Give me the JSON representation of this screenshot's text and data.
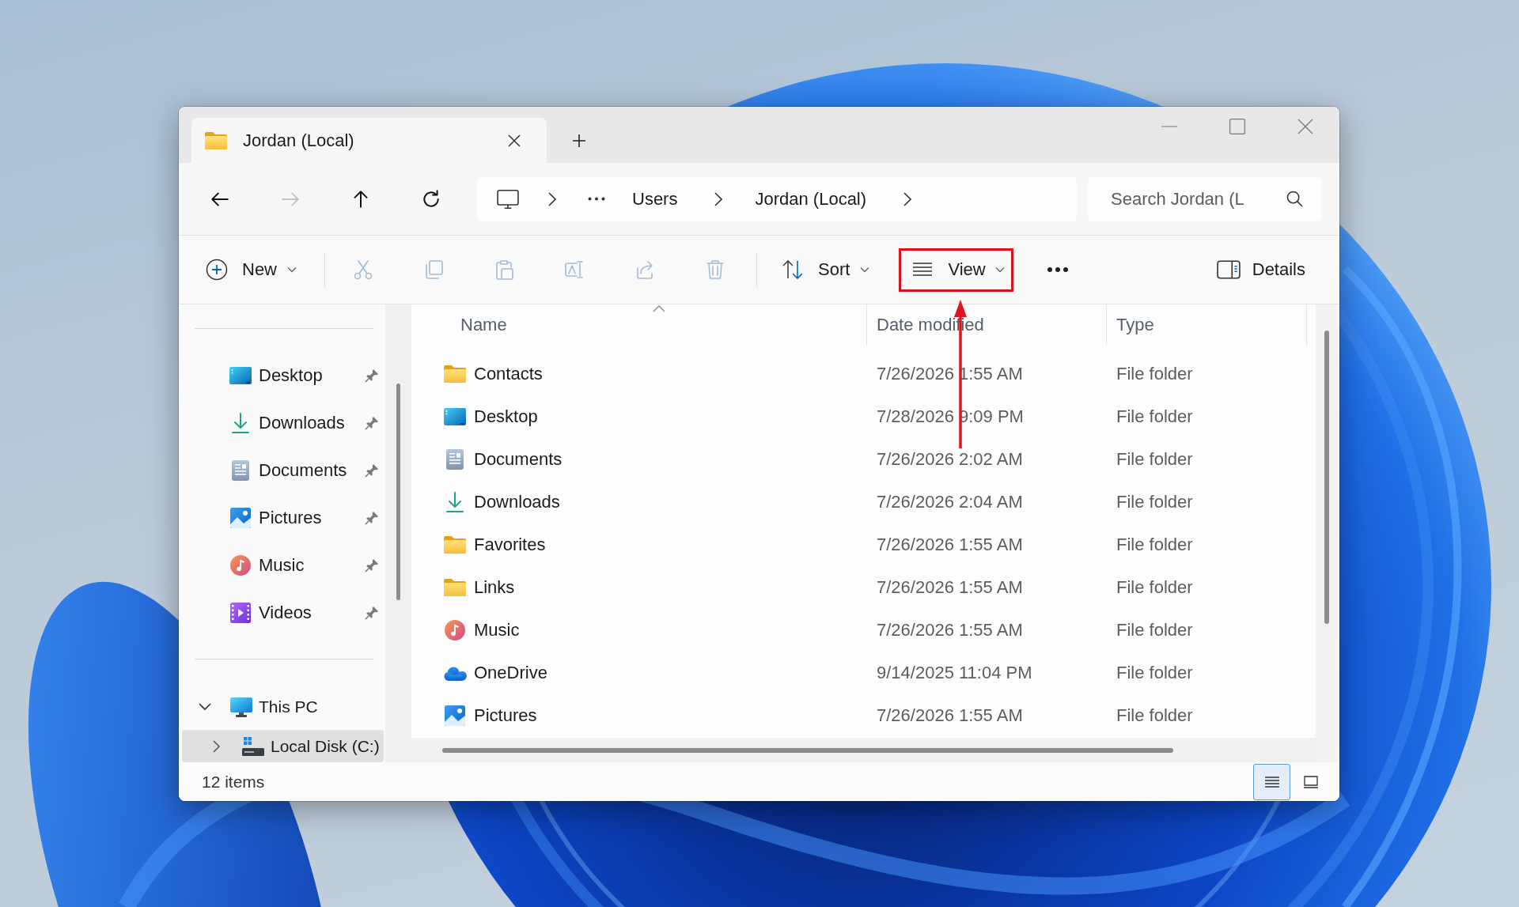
{
  "window": {
    "tabs": [
      {
        "label": "Jordan (Local)",
        "selected": true
      }
    ]
  },
  "navigation": [
    {
      "kind": "back",
      "disabled": false
    },
    {
      "kind": "forward",
      "disabled": true
    },
    {
      "kind": "up",
      "disabled": false
    },
    {
      "kind": "refresh",
      "disabled": false
    }
  ],
  "address_bar": {
    "segments": [
      "Users",
      "Jordan (Local)"
    ]
  },
  "search": {
    "placeholder": "Search Jordan (L"
  },
  "toolbar": {
    "new": {
      "label": "New"
    },
    "actions": [
      {
        "kind": "cut",
        "disabled": true
      },
      {
        "kind": "copy",
        "disabled": true
      },
      {
        "kind": "paste",
        "disabled": true
      },
      {
        "kind": "rename",
        "disabled": true
      },
      {
        "kind": "share",
        "disabled": true
      },
      {
        "kind": "delete",
        "disabled": true
      }
    ],
    "sort": {
      "label": "Sort"
    },
    "view": {
      "label": "View",
      "highlighted": true
    },
    "details": {
      "label": "Details"
    }
  },
  "sidebar": {
    "quick_access": [
      {
        "label": "Desktop",
        "kind": "desktop",
        "pinned": true,
        "selected": false
      },
      {
        "label": "Downloads",
        "kind": "downloads",
        "pinned": true,
        "selected": false
      },
      {
        "label": "Documents",
        "kind": "documents",
        "pinned": true,
        "selected": false
      },
      {
        "label": "Pictures",
        "kind": "pictures",
        "pinned": true,
        "selected": false
      },
      {
        "label": "Music",
        "kind": "music",
        "pinned": true,
        "selected": false
      },
      {
        "label": "Videos",
        "kind": "videos",
        "pinned": true,
        "selected": false
      }
    ],
    "tree": [
      {
        "label": "This PC",
        "kind": "pc",
        "expanded": true,
        "selected": false,
        "children": [
          {
            "label": "Local Disk (C:)",
            "kind": "disk",
            "expanded": false,
            "selected": true
          }
        ]
      }
    ]
  },
  "file_list": {
    "columns": [
      {
        "label": "Name",
        "sorted": true
      },
      {
        "label": "Date modified",
        "sorted": false
      },
      {
        "label": "Type",
        "sorted": false
      }
    ],
    "rows": [
      {
        "name": "Contacts",
        "kind": "folder",
        "date_modified": "7/26/2026 1:55 AM",
        "type": "File folder",
        "selected": false
      },
      {
        "name": "Desktop",
        "kind": "desktop",
        "date_modified": "7/28/2026 9:09 PM",
        "type": "File folder",
        "selected": false
      },
      {
        "name": "Documents",
        "kind": "documents",
        "date_modified": "7/26/2026 2:02 AM",
        "type": "File folder",
        "selected": false
      },
      {
        "name": "Downloads",
        "kind": "downloads",
        "date_modified": "7/26/2026 2:04 AM",
        "type": "File folder",
        "selected": false
      },
      {
        "name": "Favorites",
        "kind": "folder",
        "date_modified": "7/26/2026 1:55 AM",
        "type": "File folder",
        "selected": false
      },
      {
        "name": "Links",
        "kind": "folder",
        "date_modified": "7/26/2026 1:55 AM",
        "type": "File folder",
        "selected": false
      },
      {
        "name": "Music",
        "kind": "music",
        "date_modified": "7/26/2026 1:55 AM",
        "type": "File folder",
        "selected": false
      },
      {
        "name": "OneDrive",
        "kind": "cloud",
        "date_modified": "9/14/2025 11:04 PM",
        "type": "File folder",
        "selected": false
      },
      {
        "name": "Pictures",
        "kind": "pictures",
        "date_modified": "7/26/2026 1:55 AM",
        "type": "File folder",
        "selected": false
      }
    ]
  },
  "status_bar": {
    "item_count": "12 items",
    "view_modes": [
      {
        "kind": "details",
        "selected": true
      },
      {
        "kind": "tiles",
        "selected": false
      }
    ]
  }
}
